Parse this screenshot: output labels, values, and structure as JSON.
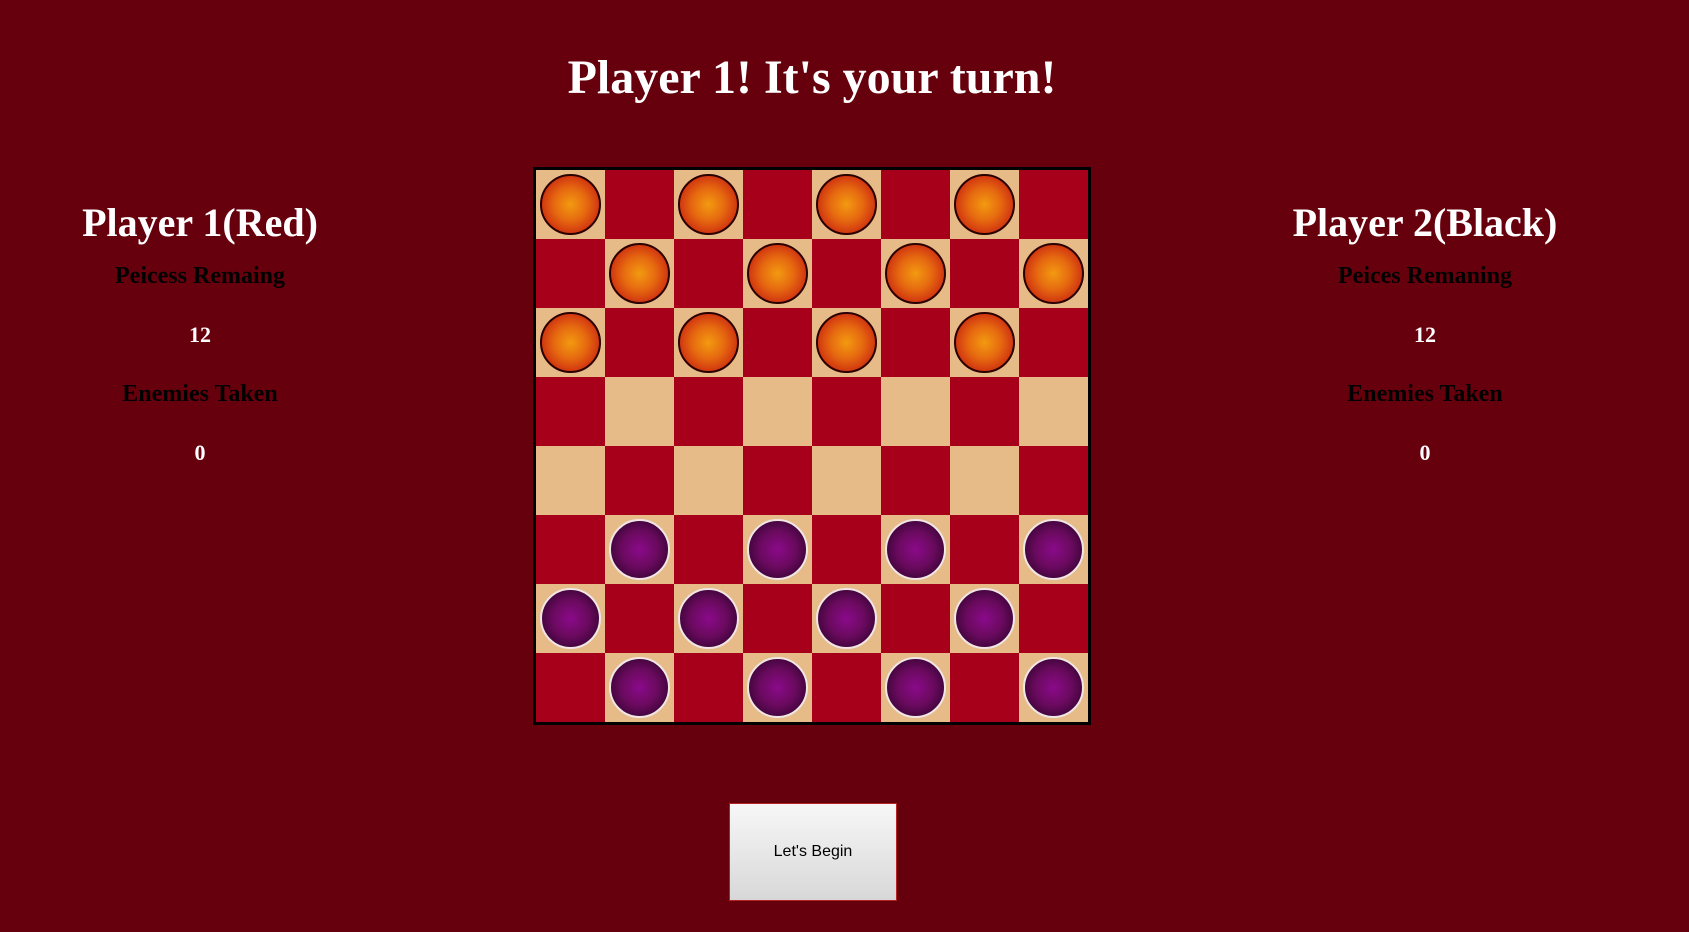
{
  "turn_message": "Player 1! It's your turn!",
  "players": [
    {
      "name": "Player 1(Red)",
      "remaining_label": "Peicess Remaing",
      "remaining_value": "12",
      "taken_label": "Enemies Taken",
      "taken_value": "0"
    },
    {
      "name": "Player 2(Black)",
      "remaining_label": "Peices Remaning",
      "remaining_value": "12",
      "taken_label": "Enemies Taken",
      "taken_value": "0"
    }
  ],
  "board": {
    "rows": [
      "R.R.R.R.",
      ".R.R.R.R",
      "R.R.R.R.",
      "........",
      "........",
      ".B.B.B.B",
      "B.B.B.B.",
      ".B.B.B.B"
    ],
    "colors": {
      "light_square": "#e7bb88",
      "dark_square": "#a6001a",
      "red_piece": "#e66a10",
      "black_piece": "#6a0a5e"
    }
  },
  "begin_button_label": "Let's Begin",
  "colors": {
    "background": "#66000c"
  }
}
